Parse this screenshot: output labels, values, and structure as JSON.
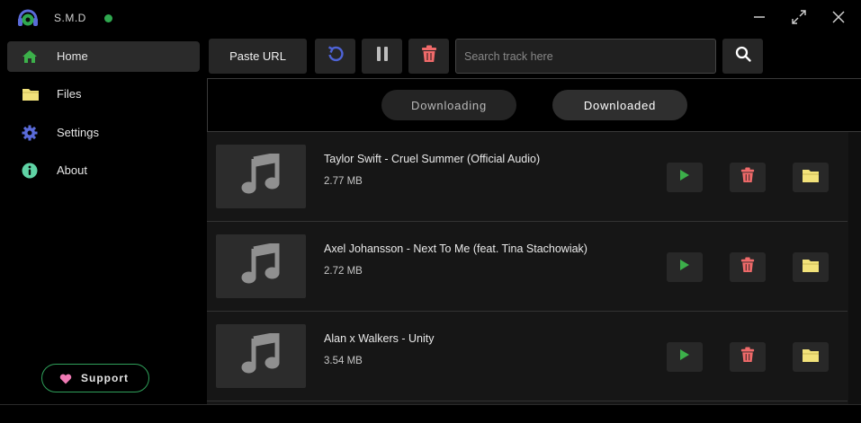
{
  "app": {
    "name": "S.M.D"
  },
  "window": {
    "controls": [
      "minimize-icon",
      "maximize-icon",
      "close-icon"
    ]
  },
  "sidebar": {
    "items": [
      {
        "label": "Home",
        "icon": "home-icon",
        "active": true
      },
      {
        "label": "Files",
        "icon": "folder-icon",
        "active": false
      },
      {
        "label": "Settings",
        "icon": "gear-icon",
        "active": false
      },
      {
        "label": "About",
        "icon": "info-icon",
        "active": false
      }
    ],
    "support_label": "Support"
  },
  "toolbar": {
    "paste_label": "Paste URL",
    "refresh_icon": "refresh-icon",
    "pause_icon": "pause-icon",
    "delete_icon": "trash-icon",
    "search_icon": "search-icon"
  },
  "search": {
    "placeholder": "Search track here",
    "value": ""
  },
  "tabs": [
    {
      "label": "Downloading",
      "active": false
    },
    {
      "label": "Downloaded",
      "active": true
    }
  ],
  "tracks": [
    {
      "title": "Taylor Swift - Cruel Summer (Official Audio)",
      "size": "2.77 MB"
    },
    {
      "title": "Axel Johansson - Next To Me (feat. Tina Stachowiak)",
      "size": "2.72 MB"
    },
    {
      "title": "Alan x Walkers - Unity",
      "size": "3.54 MB"
    }
  ],
  "colors": {
    "accent_green": "#2fa84f",
    "play_green": "#3cb04a",
    "delete_red": "#f06a6a",
    "folder_yellow": "#f2e27a",
    "refresh_blue": "#4e63d6",
    "support_border": "#2fa05a",
    "support_heart": "#f07ab4"
  }
}
